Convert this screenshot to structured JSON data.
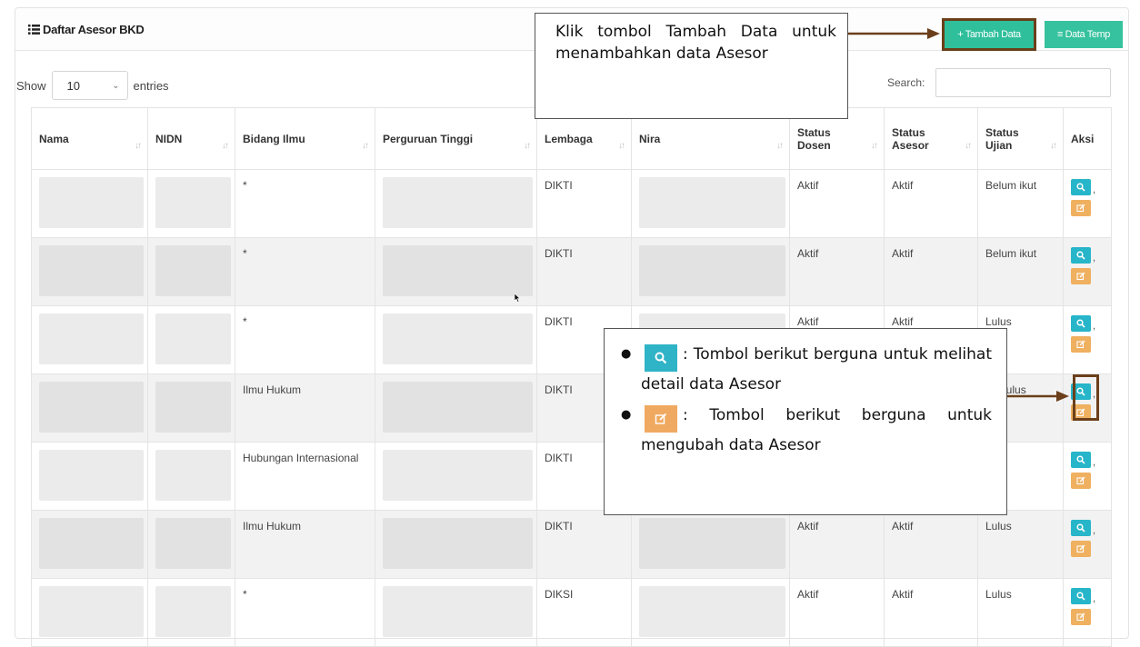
{
  "header": {
    "title": "Daftar Asesor BKD",
    "tambah_label": "+ Tambah Data",
    "temp_label": "≡ Data Temp"
  },
  "controls": {
    "show_label": "Show",
    "entries_value": "10",
    "entries_label": "entries",
    "search_label": "Search:",
    "search_value": ""
  },
  "table": {
    "columns": [
      "Nama",
      "NIDN",
      "Bidang Ilmu",
      "Perguruan Tinggi",
      "Lembaga",
      "Nira",
      "Status Dosen",
      "Status Asesor",
      "Status Ujian",
      "Aksi"
    ],
    "rows": [
      {
        "bidang": "*",
        "lembaga": "DIKTI",
        "dosen": "Aktif",
        "asesor": "Aktif",
        "ujian": "Belum ikut"
      },
      {
        "bidang": "*",
        "lembaga": "DIKTI",
        "dosen": "Aktif",
        "asesor": "Aktif",
        "ujian": "Belum ikut"
      },
      {
        "bidang": "*",
        "lembaga": "DIKTI",
        "dosen": "Aktif",
        "asesor": "Aktif",
        "ujian": "Lulus"
      },
      {
        "bidang": "Ilmu Hukum",
        "lembaga": "DIKTI",
        "dosen": "",
        "asesor": "",
        "ujian": "ak Lulus"
      },
      {
        "bidang": "Hubungan Internasional",
        "lembaga": "DIKTI",
        "dosen": "",
        "asesor": "",
        "ujian": "us"
      },
      {
        "bidang": "Ilmu Hukum",
        "lembaga": "DIKTI",
        "dosen": "Aktif",
        "asesor": "Aktif",
        "ujian": "Lulus"
      },
      {
        "bidang": "*",
        "lembaga": "DIKSI",
        "dosen": "Aktif",
        "asesor": "Aktif",
        "ujian": "Lulus"
      }
    ]
  },
  "callouts": {
    "top": "Klik tombol Tambah Data untuk menambahkan data Asesor",
    "view_text": ": Tombol berikut berguna untuk melihat detail data Asesor",
    "edit_text": ": Tombol berikut berguna untuk mengubah data Asesor"
  },
  "colors": {
    "primary_button": "#2fbf9b",
    "view_button": "#27b5c9",
    "edit_button": "#efb060",
    "annotation_arrow": "#6b3f1a"
  },
  "icons": {
    "header": "list-icon",
    "view": "search-icon",
    "edit": "edit-icon",
    "select": "chevron-down-icon"
  }
}
